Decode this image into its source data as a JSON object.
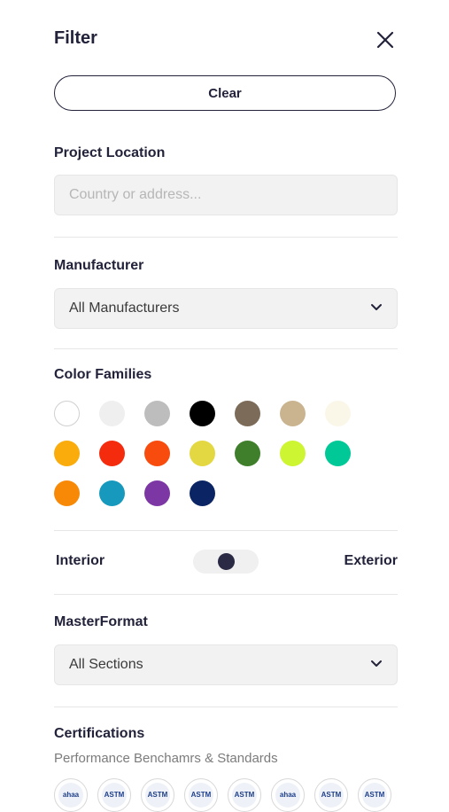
{
  "header": {
    "title": "Filter",
    "close_icon": "close-icon"
  },
  "clear_label": "Clear",
  "project_location": {
    "label": "Project Location",
    "placeholder": "Country or address..."
  },
  "manufacturer": {
    "label": "Manufacturer",
    "value": "All Manufacturers"
  },
  "color_families": {
    "label": "Color Families",
    "colors": [
      "#ffffff",
      "#efefef",
      "#bdbdbd",
      "#000000",
      "#7b6b58",
      "#c9b48f",
      "#fbf7e8",
      "#f9ac0b",
      "#f42b0d",
      "#f84b0e",
      "#e3d842",
      "#3f7f2b",
      "#cdf531",
      "#00c896",
      "#f88907",
      "#1699bc",
      "#7c37a4",
      "#0a2464"
    ]
  },
  "toggle": {
    "left_label": "Interior",
    "right_label": "Exterior"
  },
  "masterformat": {
    "label": "MasterFormat",
    "value": "All Sections"
  },
  "certifications": {
    "label": "Certifications",
    "subtitle": "Performance Benchamrs & Standards",
    "badges": [
      "ahaa",
      "ASTM",
      "ASTM",
      "ASTM",
      "ASTM",
      "ahaa",
      "ASTM",
      "ASTM"
    ]
  }
}
